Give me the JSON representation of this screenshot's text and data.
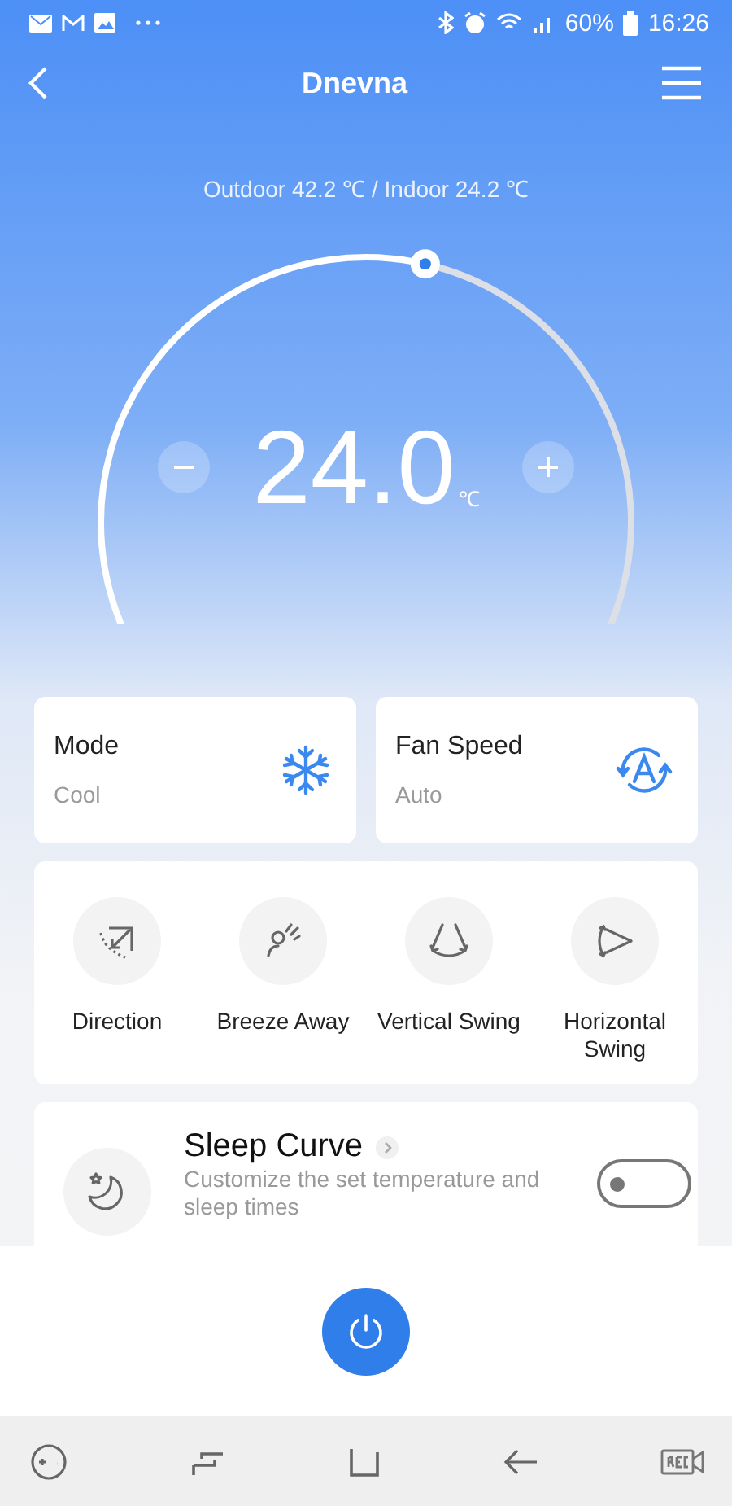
{
  "status_bar": {
    "battery": "60%",
    "time": "16:26"
  },
  "header": {
    "title": "Dnevna"
  },
  "climate": {
    "reading": "Outdoor 42.2 ℃ / Indoor 24.2 ℃"
  },
  "dial": {
    "temperature": "24.0",
    "unit": "℃"
  },
  "cards": [
    {
      "kind": "mode",
      "label": "Mode",
      "value": "Cool"
    },
    {
      "kind": "fan",
      "label": "Fan Speed",
      "value": "Auto"
    }
  ],
  "functions": [
    {
      "kind": "direction",
      "label": "Direction"
    },
    {
      "kind": "breeze",
      "label": "Breeze Away"
    },
    {
      "kind": "vertical",
      "label": "Vertical Swing"
    },
    {
      "kind": "horizontal",
      "label": "Horizontal Swing"
    }
  ],
  "sleep": {
    "title": "Sleep Curve",
    "description": "Customize the set temperature and sleep times",
    "on": false
  }
}
